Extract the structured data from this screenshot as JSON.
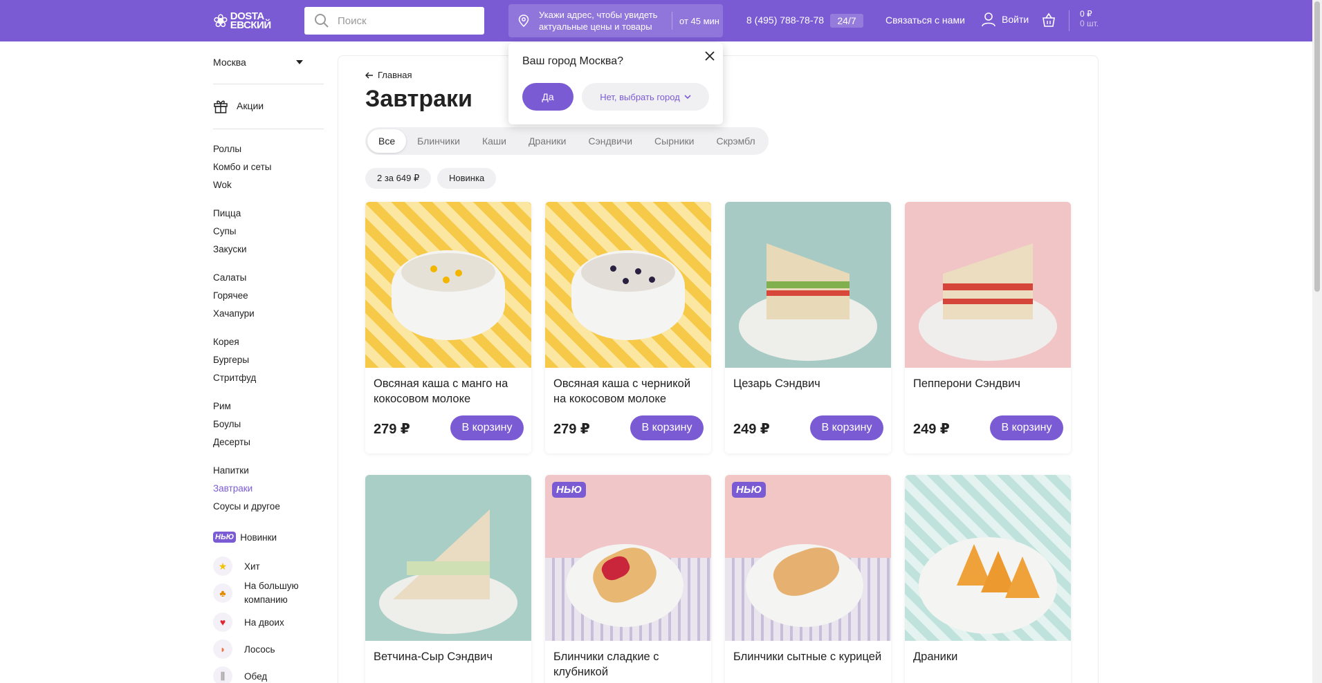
{
  "header": {
    "logo_text": "DOSTA\nЕВСКИЙ",
    "search_placeholder": "Поиск",
    "address_prompt": "Укажи адрес, чтобы увидеть актуальные цены и товары",
    "delivery_time": "от 45 мин",
    "phone": "8 (495) 788-78-78",
    "hours_badge": "24/7",
    "contact": "Связаться с нами",
    "login": "Войти",
    "cart_sum": "0 ₽",
    "cart_count": "0 шт."
  },
  "city_popup": {
    "question": "Ваш город Москва?",
    "yes": "Да",
    "no": "Нет, выбрать город"
  },
  "sidebar": {
    "city": "Москва",
    "promo": "Акции",
    "groups": [
      [
        "Роллы",
        "Комбо и сеты",
        "Wok"
      ],
      [
        "Пицца",
        "Супы",
        "Закуски"
      ],
      [
        "Салаты",
        "Горячее",
        "Хачапури"
      ],
      [
        "Корея",
        "Бургеры",
        "Стритфуд"
      ],
      [
        "Рим",
        "Боулы",
        "Десерты"
      ],
      [
        "Напитки",
        "Завтраки",
        "Соусы и другое"
      ]
    ],
    "new_badge": "НЬЮ",
    "special": [
      "Новинки",
      "Хит",
      "На большую компанию",
      "На двоих",
      "Лосось",
      "Обед"
    ]
  },
  "page": {
    "back": "Главная",
    "title": "Завтраки",
    "tabs": [
      "Все",
      "Блинчики",
      "Каши",
      "Драники",
      "Сэндвичи",
      "Сырники",
      "Скрэмбл"
    ],
    "chips": [
      "2 за 649 ₽",
      "Новинка"
    ],
    "buy_label": "В корзину",
    "new_tag": "НЬЮ"
  },
  "products": [
    {
      "name": "Овсяная каша с манго на кокосовом молоке",
      "price": "279 ₽"
    },
    {
      "name": "Овсяная каша с черникой на кокосовом молоке",
      "price": "279 ₽"
    },
    {
      "name": "Цезарь Сэндвич",
      "price": "249 ₽"
    },
    {
      "name": "Пепперони Сэндвич",
      "price": "249 ₽"
    },
    {
      "name": "Ветчина-Сыр Сэндвич"
    },
    {
      "name": "Блинчики сладкие с клубникой"
    },
    {
      "name": "Блинчики сытные с курицей"
    },
    {
      "name": "Драники"
    }
  ],
  "colors": {
    "brand": "#7b5bd3"
  }
}
